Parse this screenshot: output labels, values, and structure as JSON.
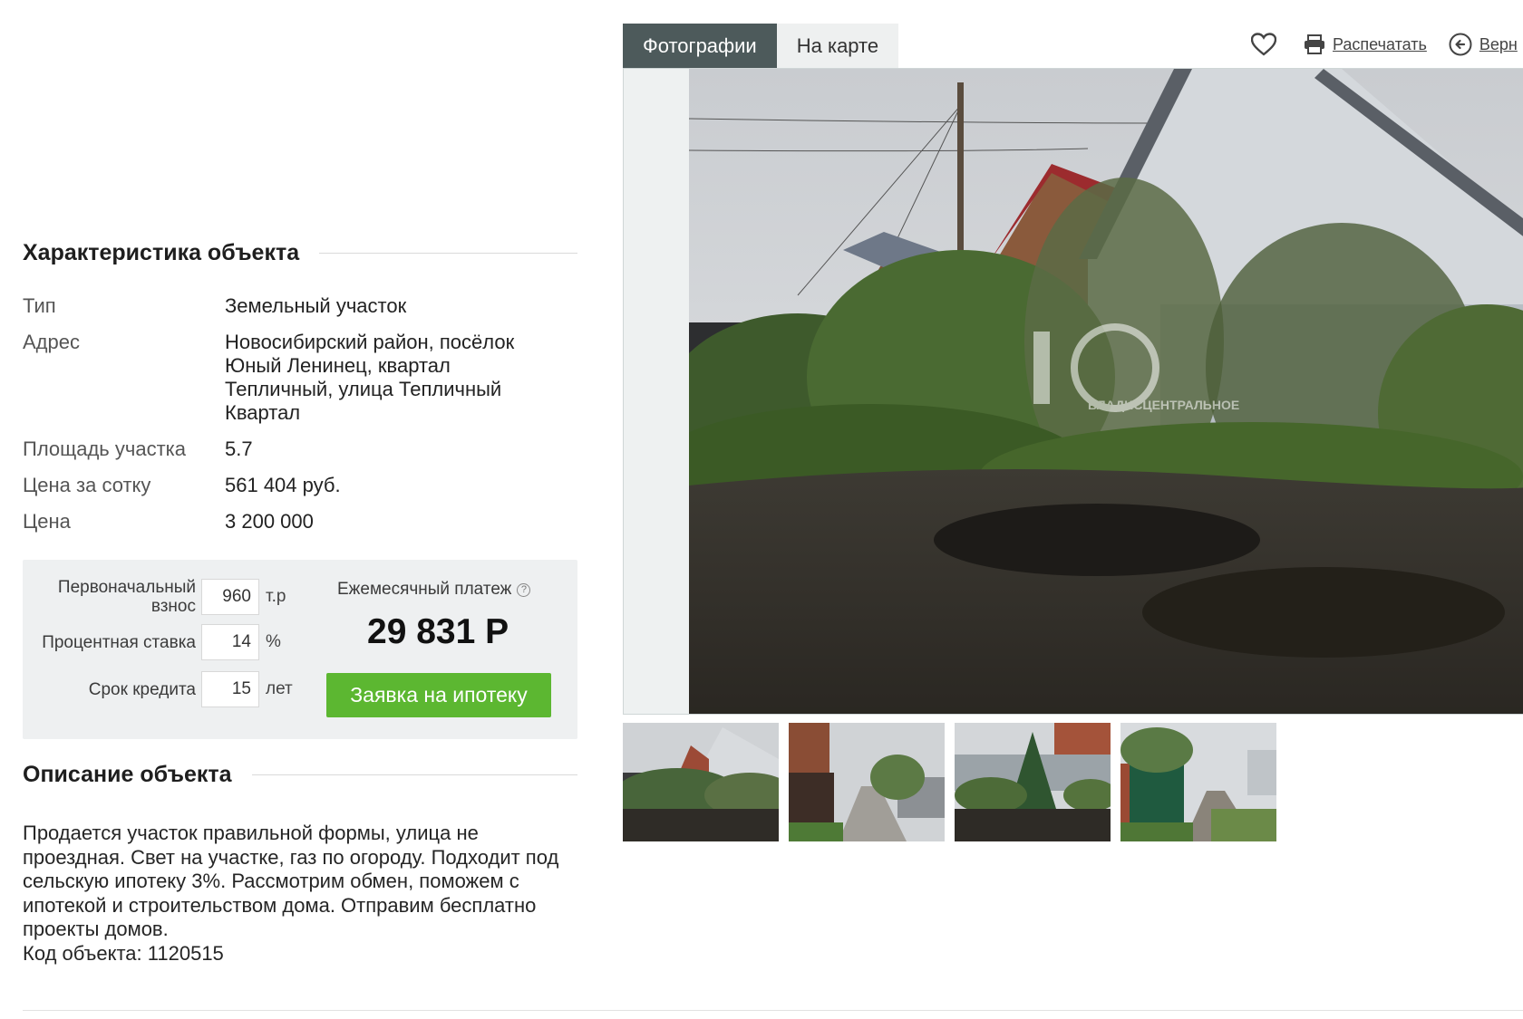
{
  "characteristics": {
    "title": "Характеристика объекта",
    "rows": [
      {
        "key": "Тип",
        "value": "Земельный участок"
      },
      {
        "key": "Адрес",
        "value": "Новосибирский район, посёлок Юный Ленинец, квартал Тепличный, улица Тепличный Квартал"
      },
      {
        "key": "Площадь участка",
        "value": "5.7"
      },
      {
        "key": "Цена за сотку",
        "value": "561 404 руб."
      },
      {
        "key": "Цена",
        "value": "3 200 000"
      }
    ]
  },
  "mortgage": {
    "down_payment_label": "Первоначальный взнос",
    "down_payment_value": "960",
    "down_payment_unit": "т.р",
    "rate_label": "Процентная ставка",
    "rate_value": "14",
    "rate_unit": "%",
    "term_label": "Срок кредита",
    "term_value": "15",
    "term_unit": "лет",
    "monthly_label": "Ежемесячный платеж",
    "help_glyph": "?",
    "monthly_value": "29 831 Р",
    "apply_label": "Заявка на ипотеку"
  },
  "description": {
    "title": "Описание объекта",
    "text": "Продается участок правильной формы, улица не проездная. Свет на участке, газ по огороду. Подходит под сельскую ипотеку 3%. Рассмотрим обмен, поможем с ипотекой и строительством дома. Отправим бесплатно проекты домов.",
    "code": "Код объекта: 1120515"
  },
  "gallery": {
    "tabs": [
      {
        "label": "Фотографии",
        "active": true
      },
      {
        "label": "На карте",
        "active": false
      }
    ],
    "print_label": "Распечатать",
    "back_label": "Верн",
    "watermark_text": "ВЛАДИСЦЕНТРАЛЬНОЕ",
    "thumbnail_count": 4
  },
  "icons": {
    "favorite": "heart-icon",
    "print": "printer-icon",
    "back": "back-arrow-icon"
  },
  "colors": {
    "tab_active_bg": "#4d5a5b",
    "apply_button": "#5cb731",
    "mortgage_bg": "#eef0f1"
  }
}
